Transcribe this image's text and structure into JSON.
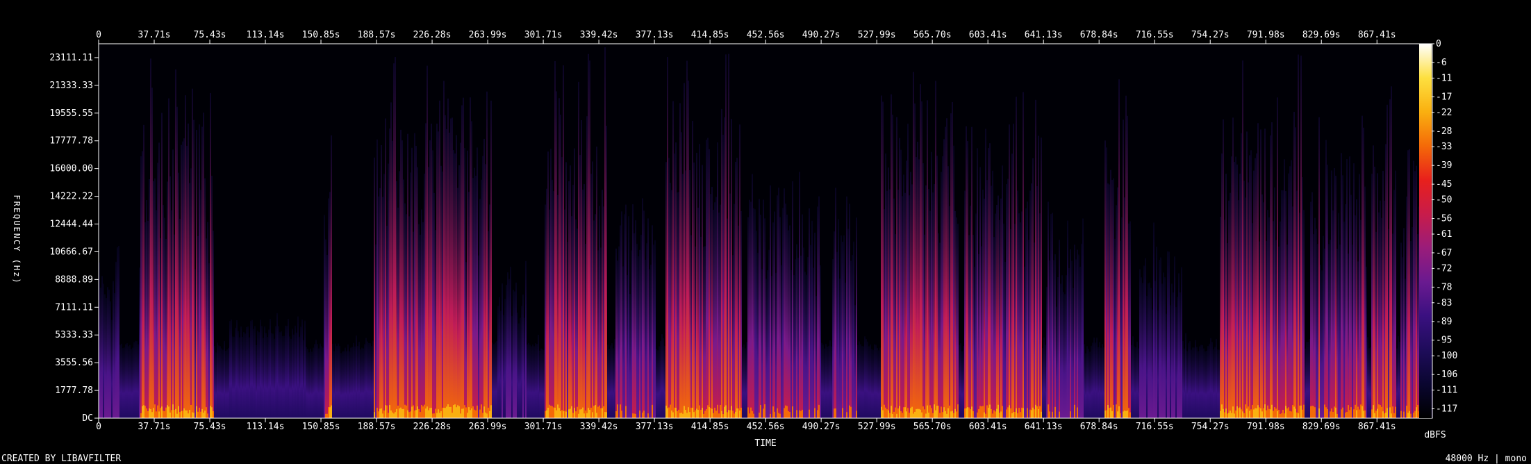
{
  "chart_data": {
    "type": "heatmap",
    "title": "",
    "xlabel": "TIME",
    "ylabel": "FREQUENCY (Hz)",
    "x_ticks_top": [
      "0",
      "37.71s",
      "75.43s",
      "113.14s",
      "150.85s",
      "188.57s",
      "226.28s",
      "263.99s",
      "301.71s",
      "339.42s",
      "377.13s",
      "414.85s",
      "452.56s",
      "490.27s",
      "527.99s",
      "565.70s",
      "603.41s",
      "641.13s",
      "678.84s",
      "716.55s",
      "754.27s",
      "791.98s",
      "829.69s",
      "867.41s"
    ],
    "x_ticks_bottom": [
      "0",
      "37.71s",
      "75.43s",
      "113.14s",
      "150.85s",
      "188.57s",
      "226.28s",
      "263.99s",
      "301.71s",
      "339.42s",
      "377.13s",
      "414.85s",
      "452.56s",
      "490.27s",
      "527.99s",
      "565.70s",
      "603.41s",
      "641.13s",
      "678.84s",
      "716.55s",
      "754.27s",
      "791.98s",
      "829.69s",
      "867.41s"
    ],
    "x_tick_values": [
      0,
      37.71,
      75.43,
      113.14,
      150.85,
      188.57,
      226.28,
      263.99,
      301.71,
      339.42,
      377.13,
      414.85,
      452.56,
      490.27,
      527.99,
      565.7,
      603.41,
      641.13,
      678.84,
      716.55,
      754.27,
      791.98,
      829.69,
      867.41
    ],
    "xlim": [
      0,
      905
    ],
    "y_ticks": [
      "23111.11",
      "21333.33",
      "19555.55",
      "17777.78",
      "16000.00",
      "14222.22",
      "12444.44",
      "10666.67",
      "8888.89",
      "7111.11",
      "5333.33",
      "3555.56",
      "1777.78",
      "DC"
    ],
    "y_tick_values": [
      23111.11,
      21333.33,
      19555.55,
      17777.78,
      16000.0,
      14222.22,
      12444.44,
      10666.67,
      8888.89,
      7111.11,
      5333.33,
      3555.56,
      1777.78,
      0
    ],
    "ylim": [
      0,
      24000
    ],
    "colorbar": {
      "unit": "dBFS",
      "labels": [
        "0",
        "-6",
        "-11",
        "-17",
        "-22",
        "-28",
        "-33",
        "-39",
        "-45",
        "-50",
        "-56",
        "-61",
        "-67",
        "-72",
        "-78",
        "-83",
        "-89",
        "-95",
        "-100",
        "-106",
        "-111",
        "-117"
      ],
      "range": [
        -120,
        0
      ],
      "colors": [
        "#000000",
        "#0a0630",
        "#1e0c5a",
        "#3a1080",
        "#6a1a90",
        "#9a1c7a",
        "#c81c4a",
        "#e8201c",
        "#f46a08",
        "#fab010",
        "#fde040",
        "#ffffff"
      ]
    },
    "activity_segments": [
      {
        "start": 0,
        "end": 14,
        "level": 0.35
      },
      {
        "start": 27,
        "end": 78,
        "level": 0.85
      },
      {
        "start": 88,
        "end": 140,
        "level": 0.15
      },
      {
        "start": 152,
        "end": 158,
        "level": 0.8
      },
      {
        "start": 186,
        "end": 266,
        "level": 0.9
      },
      {
        "start": 270,
        "end": 290,
        "level": 0.3
      },
      {
        "start": 302,
        "end": 345,
        "level": 0.9
      },
      {
        "start": 350,
        "end": 378,
        "level": 0.6
      },
      {
        "start": 384,
        "end": 436,
        "level": 0.9
      },
      {
        "start": 440,
        "end": 490,
        "level": 0.6
      },
      {
        "start": 497,
        "end": 514,
        "level": 0.5
      },
      {
        "start": 530,
        "end": 583,
        "level": 0.95
      },
      {
        "start": 587,
        "end": 640,
        "level": 0.8
      },
      {
        "start": 642,
        "end": 668,
        "level": 0.5
      },
      {
        "start": 682,
        "end": 700,
        "level": 0.85
      },
      {
        "start": 706,
        "end": 735,
        "level": 0.4
      },
      {
        "start": 760,
        "end": 818,
        "level": 0.9
      },
      {
        "start": 822,
        "end": 860,
        "level": 0.7
      },
      {
        "start": 863,
        "end": 880,
        "level": 0.85
      },
      {
        "start": 883,
        "end": 904,
        "level": 0.75
      }
    ]
  },
  "footer": {
    "left": "CREATED BY LIBAVFILTER",
    "right": "48000 Hz | mono"
  }
}
